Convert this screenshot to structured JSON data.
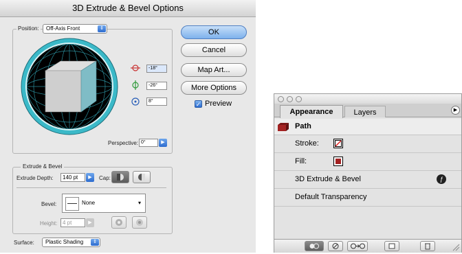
{
  "dialog": {
    "title": "3D Extrude & Bevel Options",
    "position_label": "Position:",
    "position_value": "Off-Axis Front",
    "rotation_x": "-18°",
    "rotation_y": "-26°",
    "rotation_z": "8°",
    "perspective_label": "Perspective:",
    "perspective_value": "0°",
    "buttons": {
      "ok": "OK",
      "cancel": "Cancel",
      "map_art": "Map Art...",
      "more_options": "More Options"
    },
    "preview_label": "Preview",
    "preview_checked": true,
    "extrude_section_title": "Extrude & Bevel",
    "extrude_depth_label": "Extrude Depth:",
    "extrude_depth_value": "140 pt",
    "cap_label": "Cap:",
    "bevel_label": "Bevel:",
    "bevel_value": "None",
    "height_label": "Height:",
    "height_value": "4 pt",
    "surface_label": "Surface:",
    "surface_value": "Plastic Shading"
  },
  "panel": {
    "tabs": [
      "Appearance",
      "Layers"
    ],
    "object_label": "Path",
    "rows": [
      {
        "label": "Stroke:"
      },
      {
        "label": "Fill:"
      },
      {
        "label": "3D Extrude & Bevel"
      },
      {
        "label": "Default Transparency"
      }
    ],
    "fill_color": "#a32222",
    "stroke_color": "none"
  }
}
